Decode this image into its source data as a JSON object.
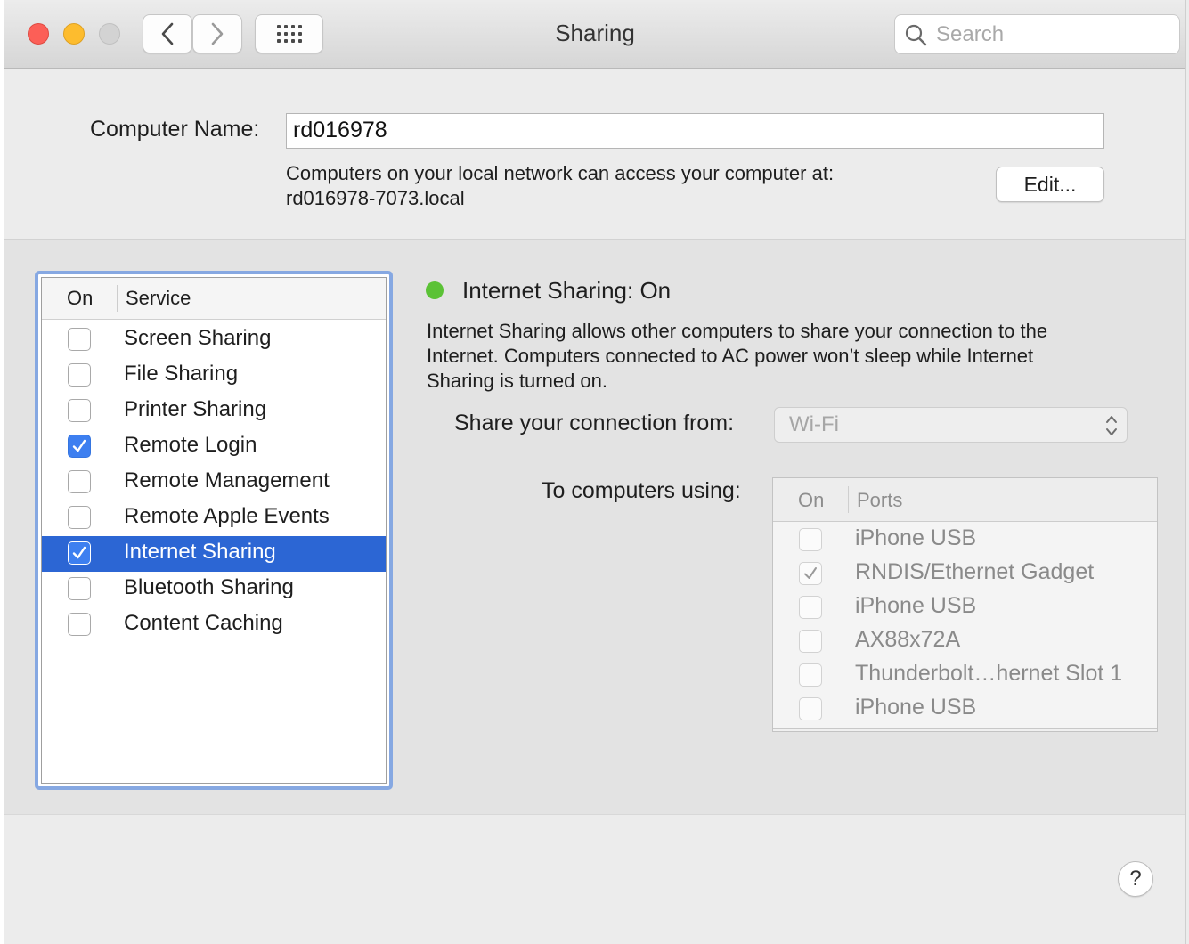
{
  "window": {
    "title": "Sharing",
    "search_placeholder": "Search"
  },
  "computer_name": {
    "label": "Computer Name:",
    "value": "rd016978",
    "access_line1": "Computers on your local network can access your computer at:",
    "access_line2": "rd016978-7073.local",
    "edit_label": "Edit..."
  },
  "services": {
    "header_on": "On",
    "header_service": "Service",
    "items": [
      {
        "label": "Screen Sharing",
        "checked": false,
        "selected": false
      },
      {
        "label": "File Sharing",
        "checked": false,
        "selected": false
      },
      {
        "label": "Printer Sharing",
        "checked": false,
        "selected": false
      },
      {
        "label": "Remote Login",
        "checked": true,
        "selected": false
      },
      {
        "label": "Remote Management",
        "checked": false,
        "selected": false
      },
      {
        "label": "Remote Apple Events",
        "checked": false,
        "selected": false
      },
      {
        "label": "Internet Sharing",
        "checked": true,
        "selected": true
      },
      {
        "label": "Bluetooth Sharing",
        "checked": false,
        "selected": false
      },
      {
        "label": "Content Caching",
        "checked": false,
        "selected": false
      }
    ]
  },
  "detail": {
    "status_title": "Internet Sharing: On",
    "status_color": "#5bc236",
    "description_line1": "Internet Sharing allows other computers to share your connection to the",
    "description_line2": "Internet. Computers connected to AC power won’t sleep while Internet",
    "description_line3": "Sharing is turned on.",
    "share_from_label": "Share your connection from:",
    "share_from_value": "Wi-Fi",
    "to_computers_label": "To computers using:",
    "ports_header_on": "On",
    "ports_header_ports": "Ports",
    "ports": [
      {
        "label": "iPhone USB",
        "checked": false
      },
      {
        "label": "RNDIS/Ethernet Gadget",
        "checked": true
      },
      {
        "label": "iPhone USB",
        "checked": false
      },
      {
        "label": "AX88x72A",
        "checked": false
      },
      {
        "label": "Thunderbolt…hernet Slot 1",
        "checked": false
      },
      {
        "label": "iPhone USB",
        "checked": false
      }
    ]
  },
  "help_label": "?",
  "accent_color": "#2c66d4"
}
